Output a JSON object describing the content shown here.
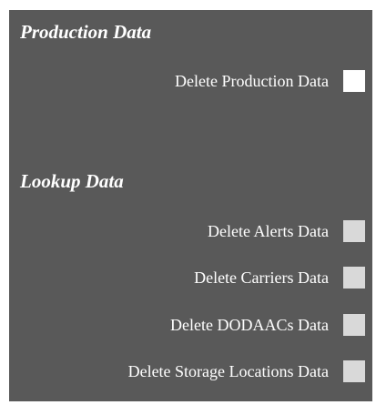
{
  "production": {
    "heading": "Production Data",
    "items": [
      {
        "label": "Delete Production Data",
        "checked": false
      }
    ]
  },
  "lookup": {
    "heading": "Lookup Data",
    "items": [
      {
        "label": "Delete Alerts Data",
        "checked": false
      },
      {
        "label": "Delete Carriers Data",
        "checked": false
      },
      {
        "label": "Delete DODAACs Data",
        "checked": false
      },
      {
        "label": "Delete Storage Locations Data",
        "checked": false
      }
    ]
  },
  "colors": {
    "panel_background": "#595959",
    "text": "#ffffff",
    "checkbox_enabled": "#ffffff",
    "checkbox_disabled": "#d9d9d9"
  }
}
